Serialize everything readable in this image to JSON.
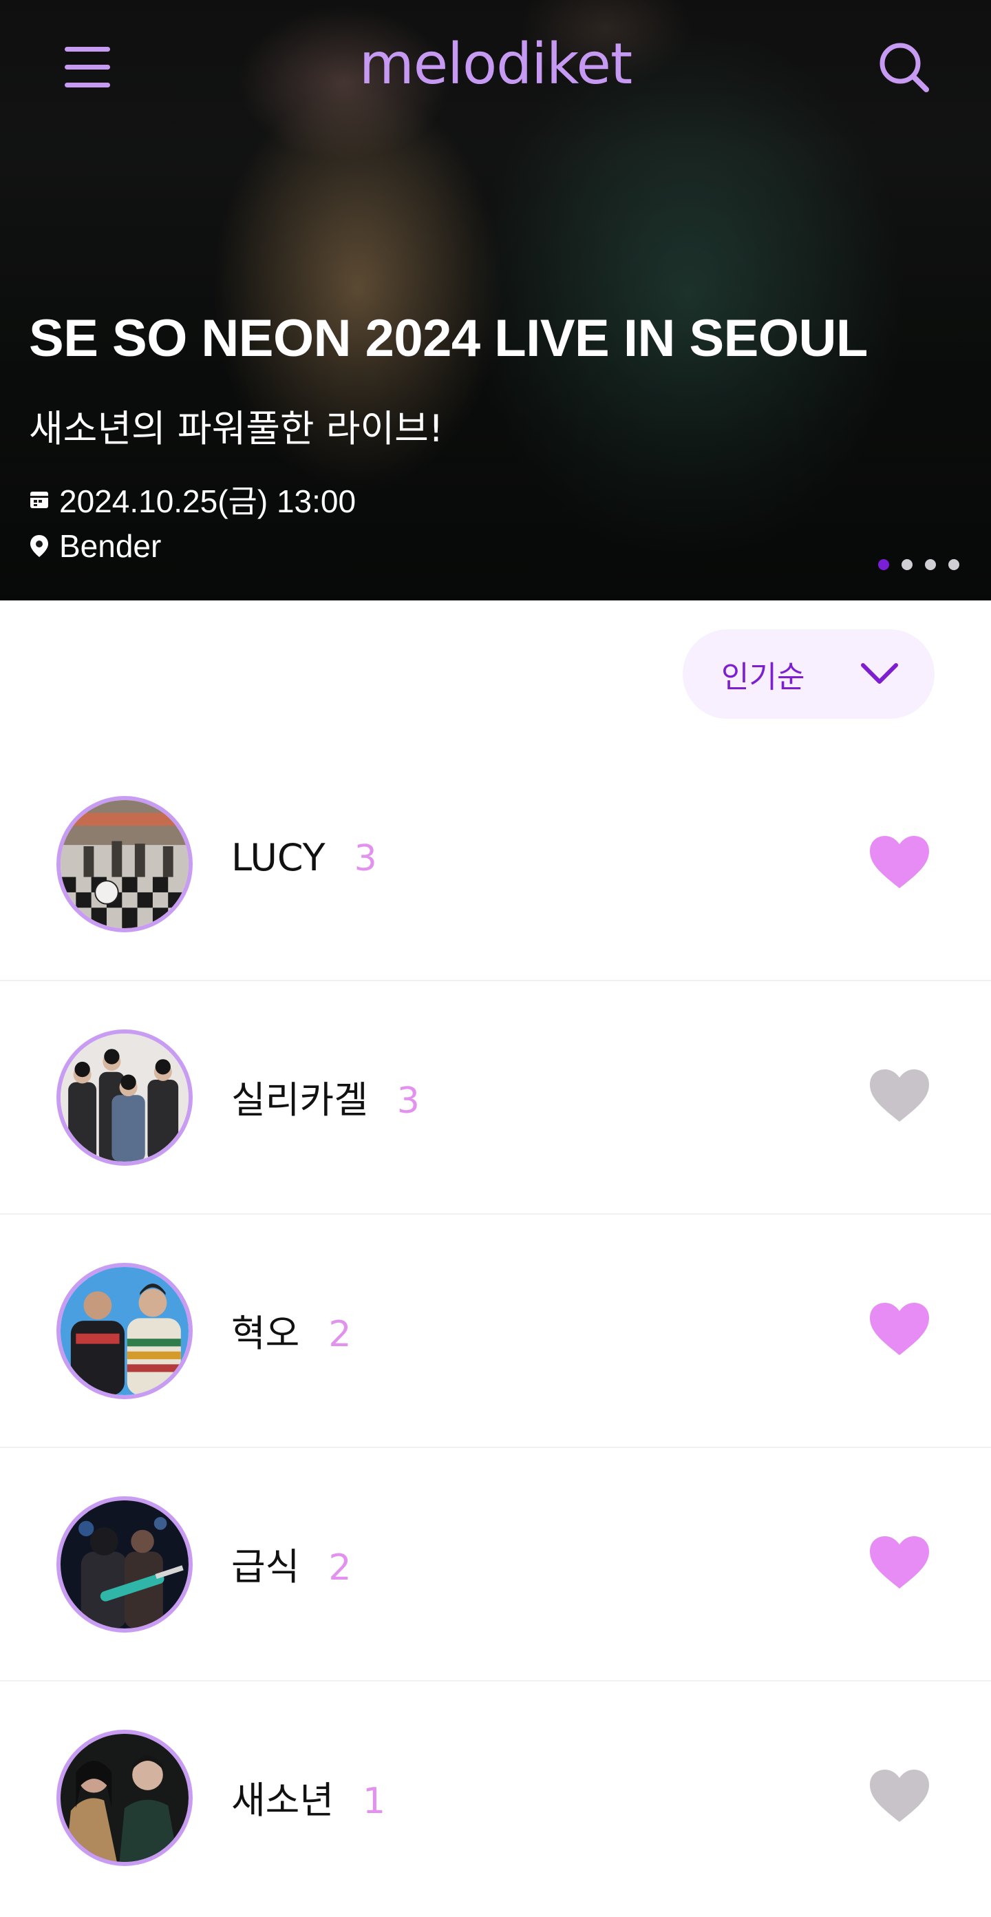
{
  "app": {
    "logo": "melodiket"
  },
  "header": {
    "menu_icon": "menu-icon",
    "search_icon": "search-icon",
    "icon_color": "#c79bf2"
  },
  "hero": {
    "title": "SE SO NEON 2024 LIVE IN SEOUL",
    "subtitle": "새소년의 파워풀한 라이브!",
    "date": "2024.10.25(금) 13:00",
    "venue": "Bender",
    "date_icon": "calendar-icon",
    "venue_icon": "location-pin-icon",
    "slides_total": 4,
    "active_slide": 1
  },
  "sort": {
    "selected": "인기순",
    "icon": "chevron-down-icon",
    "color": "#7d1fd0",
    "bg": "#f8f0ff"
  },
  "artists": [
    {
      "name": "LUCY",
      "count": "3",
      "liked": true
    },
    {
      "name": "실리카겔",
      "count": "3",
      "liked": false
    },
    {
      "name": "혁오",
      "count": "2",
      "liked": true
    },
    {
      "name": "급식",
      "count": "2",
      "liked": true
    },
    {
      "name": "새소년",
      "count": "1",
      "liked": false
    }
  ],
  "colors": {
    "accent": "#c69af2",
    "heart_liked": "#e68cf4",
    "heart_unliked": "#c8c3c9",
    "count": "#e292ee"
  }
}
